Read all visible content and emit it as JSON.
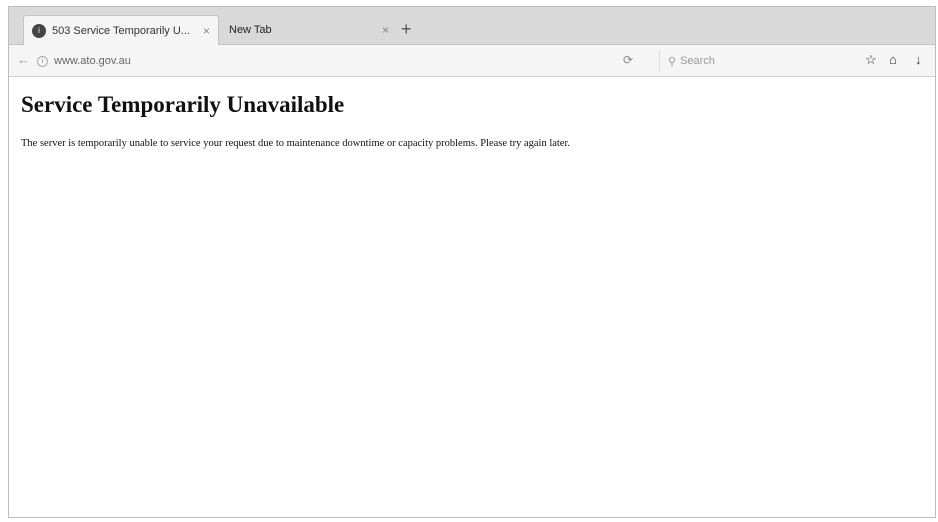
{
  "tabs": [
    {
      "title": "503 Service Temporarily U...",
      "favicon": "503-favicon",
      "close": "×",
      "active": true
    },
    {
      "title": "New Tab",
      "close": "×",
      "active": false
    }
  ],
  "new_tab_symbol": "+",
  "nav": {
    "back_symbol": "←",
    "url": "www.ato.gov.au",
    "reload_symbol": "⟳",
    "search_placeholder": "Search",
    "search_symbol": "⚲"
  },
  "toolbar_icons": {
    "bookmark": "☆",
    "library": "⌂",
    "download": "↓"
  },
  "page": {
    "heading": "Service Temporarily Unavailable",
    "message": "The server is temporarily unable to service your request due to maintenance downtime or capacity problems. Please try again later."
  }
}
